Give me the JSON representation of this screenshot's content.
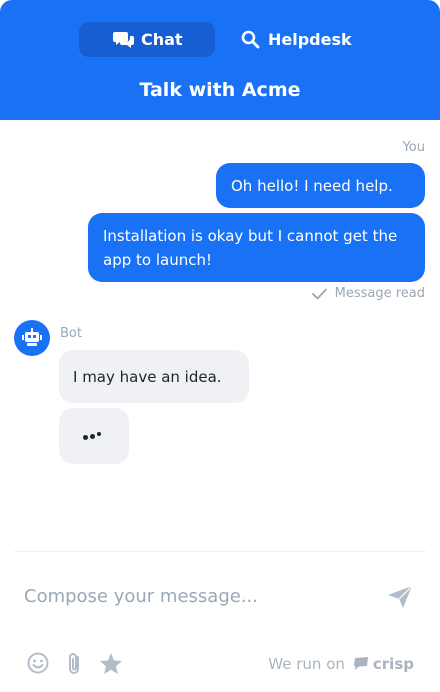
{
  "header": {
    "tabs": [
      {
        "label": "Chat",
        "icon": "chat-bubbles-icon",
        "active": true
      },
      {
        "label": "Helpdesk",
        "icon": "search-icon",
        "active": false
      }
    ],
    "title": "Talk with Acme"
  },
  "conversation": {
    "user_label": "You",
    "user_messages": [
      "Oh hello! I need help.",
      "Installation is okay but I cannot get the app to launch!"
    ],
    "read_status": "Message read",
    "bot_label": "Bot",
    "bot_messages": [
      "I may have an idea."
    ],
    "typing_indicator": true
  },
  "composer": {
    "placeholder": "Compose your message...",
    "send_icon": "send-paper-plane-icon",
    "tools": [
      "emoji-icon",
      "attachment-paperclip-icon",
      "star-rating-icon"
    ]
  },
  "branding": {
    "prefix": "We run on",
    "name": "crisp"
  },
  "colors": {
    "accent": "#1972f5",
    "accent_dark": "#165ed1",
    "bot_bubble": "#eff1f5",
    "muted": "#9aa7b5"
  }
}
